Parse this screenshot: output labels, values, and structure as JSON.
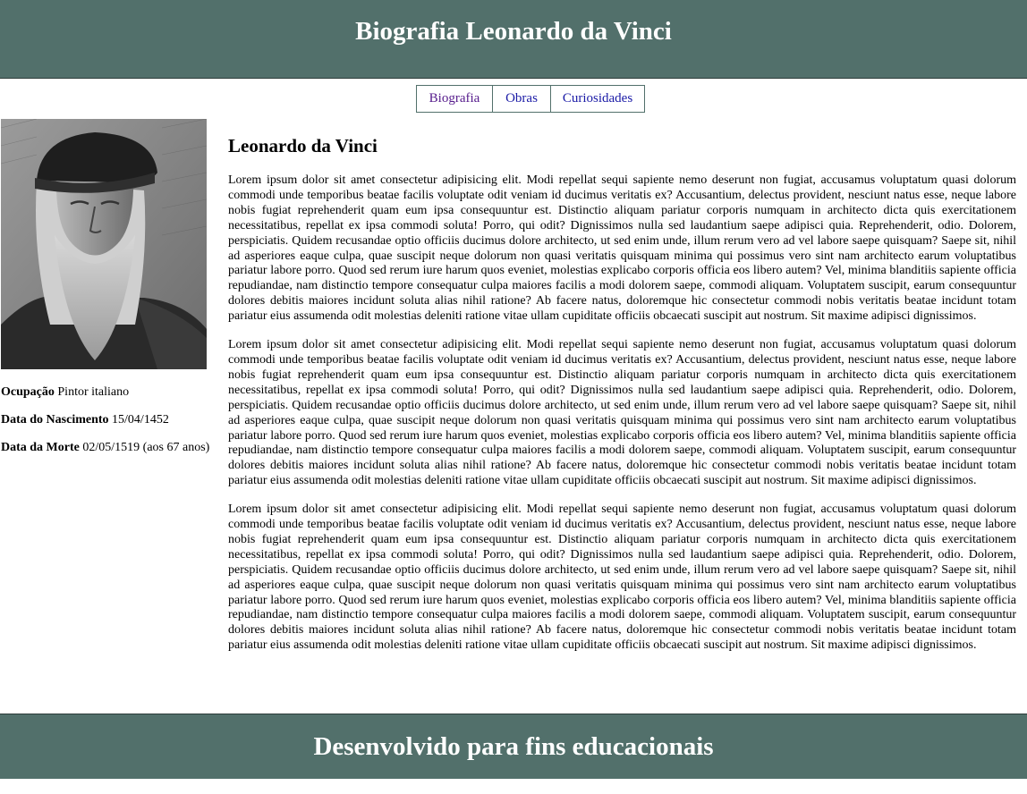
{
  "header": {
    "title": "Biografia Leonardo da Vinci"
  },
  "nav": {
    "items": [
      {
        "label": "Biografia",
        "width": 86
      },
      {
        "label": "Obras",
        "width": 66
      },
      {
        "label": "Curiosidades",
        "width": 106
      }
    ]
  },
  "sidebar": {
    "portrait_alt": "Retrato de Leonardo da Vinci",
    "occupation_label": "Ocupação",
    "occupation_value": "Pintor italiano",
    "birth_label": "Data do Nascimento",
    "birth_value": "15/04/1452",
    "death_label": "Data da Morte",
    "death_value": "02/05/1519 (aos 67 anos)"
  },
  "main": {
    "heading": "Leonardo da Vinci",
    "paragraphs": [
      "Lorem ipsum dolor sit amet consectetur adipisicing elit. Modi repellat sequi sapiente nemo deserunt non fugiat, accusamus voluptatum quasi dolorum commodi unde temporibus beatae facilis voluptate odit veniam id ducimus veritatis ex? Accusantium, delectus provident, nesciunt natus esse, neque labore nobis fugiat reprehenderit quam eum ipsa consequuntur est. Distinctio aliquam pariatur corporis numquam in architecto dicta quis exercitationem necessitatibus, repellat ex ipsa commodi soluta! Porro, qui odit? Dignissimos nulla sed laudantium saepe adipisci quia. Reprehenderit, odio. Dolorem, perspiciatis. Quidem recusandae optio officiis ducimus dolore architecto, ut sed enim unde, illum rerum vero ad vel labore saepe quisquam? Saepe sit, nihil ad asperiores eaque culpa, quae suscipit neque dolorum non quasi veritatis quisquam minima qui possimus vero sint nam architecto earum voluptatibus pariatur labore porro. Quod sed rerum iure harum quos eveniet, molestias explicabo corporis officia eos libero autem? Vel, minima blanditiis sapiente officia repudiandae, nam distinctio tempore consequatur culpa maiores facilis a modi dolorem saepe, commodi aliquam. Voluptatem suscipit, earum consequuntur dolores debitis maiores incidunt soluta alias nihil ratione? Ab facere natus, doloremque hic consectetur commodi nobis veritatis beatae incidunt totam pariatur eius assumenda odit molestias deleniti ratione vitae ullam cupiditate officiis obcaecati suscipit aut nostrum. Sit maxime adipisci dignissimos.",
      "Lorem ipsum dolor sit amet consectetur adipisicing elit. Modi repellat sequi sapiente nemo deserunt non fugiat, accusamus voluptatum quasi dolorum commodi unde temporibus beatae facilis voluptate odit veniam id ducimus veritatis ex? Accusantium, delectus provident, nesciunt natus esse, neque labore nobis fugiat reprehenderit quam eum ipsa consequuntur est. Distinctio aliquam pariatur corporis numquam in architecto dicta quis exercitationem necessitatibus, repellat ex ipsa commodi soluta! Porro, qui odit? Dignissimos nulla sed laudantium saepe adipisci quia. Reprehenderit, odio. Dolorem, perspiciatis. Quidem recusandae optio officiis ducimus dolore architecto, ut sed enim unde, illum rerum vero ad vel labore saepe quisquam? Saepe sit, nihil ad asperiores eaque culpa, quae suscipit neque dolorum non quasi veritatis quisquam minima qui possimus vero sint nam architecto earum voluptatibus pariatur labore porro. Quod sed rerum iure harum quos eveniet, molestias explicabo corporis officia eos libero autem? Vel, minima blanditiis sapiente officia repudiandae, nam distinctio tempore consequatur culpa maiores facilis a modi dolorem saepe, commodi aliquam. Voluptatem suscipit, earum consequuntur dolores debitis maiores incidunt soluta alias nihil ratione? Ab facere natus, doloremque hic consectetur commodi nobis veritatis beatae incidunt totam pariatur eius assumenda odit molestias deleniti ratione vitae ullam cupiditate officiis obcaecati suscipit aut nostrum. Sit maxime adipisci dignissimos.",
      "Lorem ipsum dolor sit amet consectetur adipisicing elit. Modi repellat sequi sapiente nemo deserunt non fugiat, accusamus voluptatum quasi dolorum commodi unde temporibus beatae facilis voluptate odit veniam id ducimus veritatis ex? Accusantium, delectus provident, nesciunt natus esse, neque labore nobis fugiat reprehenderit quam eum ipsa consequuntur est. Distinctio aliquam pariatur corporis numquam in architecto dicta quis exercitationem necessitatibus, repellat ex ipsa commodi soluta! Porro, qui odit? Dignissimos nulla sed laudantium saepe adipisci quia. Reprehenderit, odio. Dolorem, perspiciatis. Quidem recusandae optio officiis ducimus dolore architecto, ut sed enim unde, illum rerum vero ad vel labore saepe quisquam? Saepe sit, nihil ad asperiores eaque culpa, quae suscipit neque dolorum non quasi veritatis quisquam minima qui possimus vero sint nam architecto earum voluptatibus pariatur labore porro. Quod sed rerum iure harum quos eveniet, molestias explicabo corporis officia eos libero autem? Vel, minima blanditiis sapiente officia repudiandae, nam distinctio tempore consequatur culpa maiores facilis a modi dolorem saepe, commodi aliquam. Voluptatem suscipit, earum consequuntur dolores debitis maiores incidunt soluta alias nihil ratione? Ab facere natus, doloremque hic consectetur commodi nobis veritatis beatae incidunt totam pariatur eius assumenda odit molestias deleniti ratione vitae ullam cupiditate officiis obcaecati suscipit aut nostrum. Sit maxime adipisci dignissimos."
    ]
  },
  "footer": {
    "text": "Desenvolvido para fins educacionais"
  },
  "colors": {
    "header_bg": "#52706b",
    "link": "#1a1aa6",
    "link_visited": "#551a8b"
  }
}
